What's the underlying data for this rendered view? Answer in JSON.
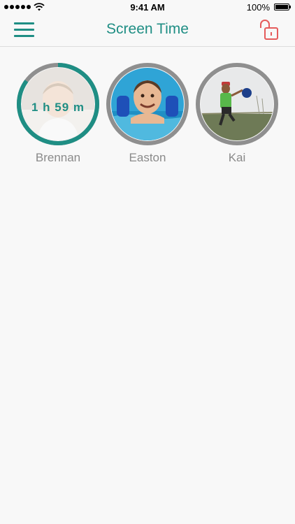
{
  "status_bar": {
    "time": "9:41 AM",
    "battery": "100%"
  },
  "nav": {
    "title": "Screen Time",
    "menu_icon": "hamburger-menu-icon",
    "lock_icon": "unlocked-padlock-icon"
  },
  "colors": {
    "accent": "#1f8e84",
    "lock": "#e55b5b",
    "ring_track": "#8f8f8f",
    "name_text": "#8a8a8a"
  },
  "profiles": [
    {
      "name": "Brennan",
      "time_used": "1 h 59 m",
      "progress": 0.85
    },
    {
      "name": "Easton",
      "time_used": ""
    },
    {
      "name": "Kai",
      "time_used": ""
    }
  ]
}
